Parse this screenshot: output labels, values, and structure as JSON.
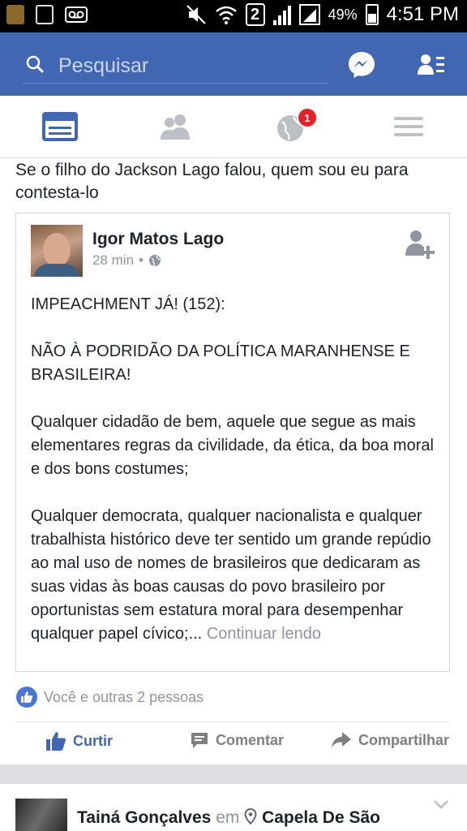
{
  "status_bar": {
    "sim": "2",
    "battery": "49%",
    "time": "4:51 PM"
  },
  "search": {
    "placeholder": "Pesquisar"
  },
  "tabs": {
    "notifications_badge": "1"
  },
  "post": {
    "text": "Se o filho do Jackson Lago falou, quem sou eu para contesta-lo",
    "shared": {
      "author": "Igor Matos Lago",
      "time": "28 min",
      "separator": "•",
      "paragraphs": [
        "IMPEACHMENT JÁ! (152):",
        "NÃO À PODRIDÃO DA POLÍTICA MARANHENSE E BRASILEIRA!",
        "Qualquer cidadão de bem, aquele que segue as mais elementares regras da civilidade, da ética, da boa moral e dos bons costumes;",
        "Qualquer democrata, qualquer nacionalista e qualquer trabalhista histórico deve ter sentido um grande repúdio ao mal uso de nomes de brasileiros que dedicaram as suas vidas às boas causas do povo brasileiro por oportunistas sem estatura moral para desempenhar qualquer papel cívico;..."
      ],
      "continue": "Continuar lendo"
    },
    "likes": "Você e outras 2 pessoas",
    "actions": {
      "like": "Curtir",
      "comment": "Comentar",
      "share": "Compartilhar"
    }
  },
  "next_post": {
    "author": "Tainá Gonçalves",
    "connector": "em",
    "place": "Capela De São"
  },
  "colors": {
    "brand": "#4267b2",
    "badge": "#e0242a"
  }
}
